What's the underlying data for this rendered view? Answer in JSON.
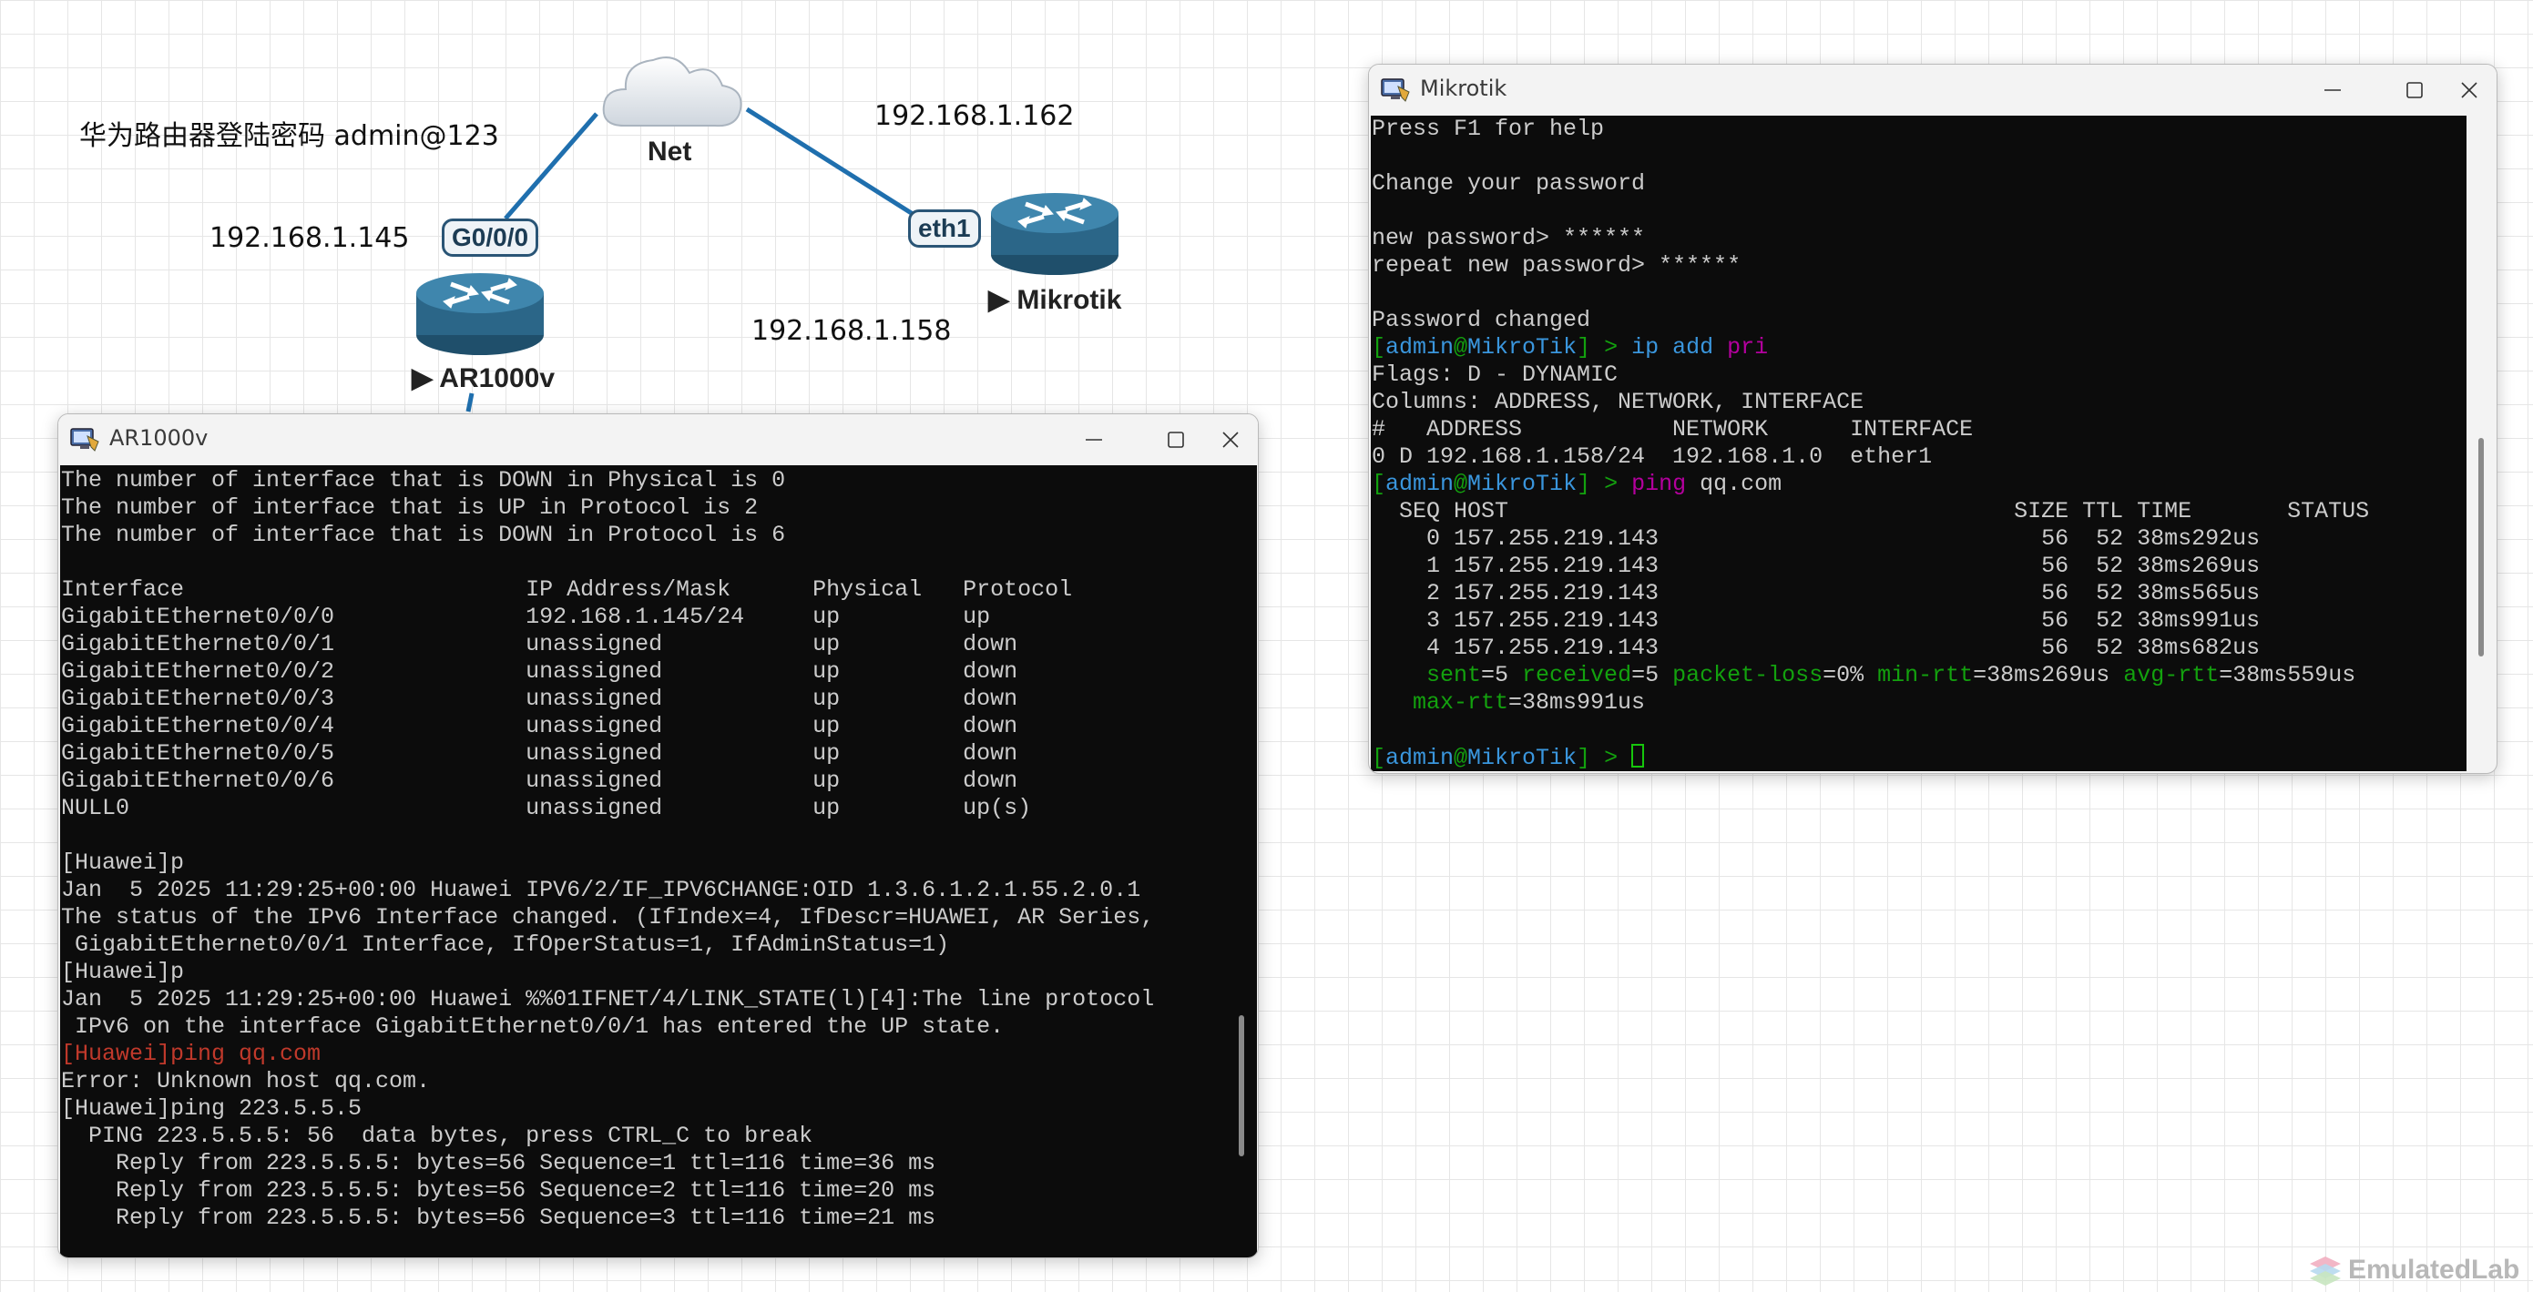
{
  "topology": {
    "note": "华为路由器登陆密码 admin@123",
    "ip_ar_side": "192.168.1.145",
    "ip_net_mikrotik": "192.168.1.162",
    "ip_mikrotik": "192.168.1.158",
    "cloud_label": "Net",
    "ar_node_label": "▶ AR1000v",
    "mikrotik_node_label": "▶ Mikrotik",
    "ar_iface_badge": "G0/0/0",
    "mikrotik_iface_badge": "eth1",
    "link_color": "#1f6fae"
  },
  "ar_window": {
    "title": "AR1000v",
    "lines": [
      [
        {
          "t": "The number of interface that is DOWN in Physical is 0"
        }
      ],
      [
        {
          "t": "The number of interface that is UP in Protocol is 2"
        }
      ],
      [
        {
          "t": "The number of interface that is DOWN in Protocol is 6"
        }
      ],
      [
        {
          "t": ""
        }
      ],
      [
        {
          "t": "Interface                         IP Address/Mask      Physical   Protocol"
        }
      ],
      [
        {
          "t": "GigabitEthernet0/0/0              192.168.1.145/24     up         up"
        }
      ],
      [
        {
          "t": "GigabitEthernet0/0/1              unassigned           up         down"
        }
      ],
      [
        {
          "t": "GigabitEthernet0/0/2              unassigned           up         down"
        }
      ],
      [
        {
          "t": "GigabitEthernet0/0/3              unassigned           up         down"
        }
      ],
      [
        {
          "t": "GigabitEthernet0/0/4              unassigned           up         down"
        }
      ],
      [
        {
          "t": "GigabitEthernet0/0/5              unassigned           up         down"
        }
      ],
      [
        {
          "t": "GigabitEthernet0/0/6              unassigned           up         down"
        }
      ],
      [
        {
          "t": "NULL0                             unassigned           up         up(s)"
        }
      ],
      [
        {
          "t": ""
        }
      ],
      [
        {
          "t": "[Huawei]p"
        }
      ],
      [
        {
          "t": "Jan  5 2025 11:29:25+00:00 Huawei IPV6/2/IF_IPV6CHANGE:OID 1.3.6.1.2.1.55.2.0.1"
        }
      ],
      [
        {
          "t": "The status of the IPv6 Interface changed. (IfIndex=4, IfDescr=HUAWEI, AR Series,"
        }
      ],
      [
        {
          "t": " GigabitEthernet0/0/1 Interface, IfOperStatus=1, IfAdminStatus=1)"
        }
      ],
      [
        {
          "t": "[Huawei]p"
        }
      ],
      [
        {
          "t": "Jan  5 2025 11:29:25+00:00 Huawei %%01IFNET/4/LINK_STATE(l)[4]:The line protocol"
        }
      ],
      [
        {
          "t": " IPv6 on the interface GigabitEthernet0/0/1 has entered the UP state."
        }
      ],
      [
        {
          "t": "[Huawei]ping qq.com",
          "c": "red"
        }
      ],
      [
        {
          "t": "Error: Unknown host qq.com."
        }
      ],
      [
        {
          "t": "[Huawei]ping 223.5.5.5"
        }
      ],
      [
        {
          "t": "  PING 223.5.5.5: 56  data bytes, press CTRL_C to break"
        }
      ],
      [
        {
          "t": "    Reply from 223.5.5.5: bytes=56 Sequence=1 ttl=116 time=36 ms"
        }
      ],
      [
        {
          "t": "    Reply from 223.5.5.5: bytes=56 Sequence=2 ttl=116 time=20 ms"
        }
      ],
      [
        {
          "t": "    Reply from 223.5.5.5: bytes=56 Sequence=3 ttl=116 time=21 ms"
        }
      ]
    ]
  },
  "mikrotik_window": {
    "title": "Mikrotik",
    "lines": [
      [
        {
          "t": "Press F1 for help"
        }
      ],
      [
        {
          "t": ""
        }
      ],
      [
        {
          "t": "Change your password"
        }
      ],
      [
        {
          "t": ""
        }
      ],
      [
        {
          "t": "new password> ******"
        }
      ],
      [
        {
          "t": "repeat new password> ******"
        }
      ],
      [
        {
          "t": ""
        }
      ],
      [
        {
          "t": "Password changed"
        }
      ],
      [
        {
          "t": "[",
          "c": "green"
        },
        {
          "t": "admin",
          "c": "cyan"
        },
        {
          "t": "@",
          "c": "green"
        },
        {
          "t": "MikroTik",
          "c": "cyan"
        },
        {
          "t": "] > ",
          "c": "green"
        },
        {
          "t": "ip add ",
          "c": "cyan"
        },
        {
          "t": "pri",
          "c": "mag"
        }
      ],
      [
        {
          "t": "Flags: D - DYNAMIC"
        }
      ],
      [
        {
          "t": "Columns: ADDRESS, NETWORK, INTERFACE"
        }
      ],
      [
        {
          "t": "#   ADDRESS           NETWORK      INTERFACE"
        }
      ],
      [
        {
          "t": "0 D 192.168.1.158/24  192.168.1.0  ether1"
        }
      ],
      [
        {
          "t": "[",
          "c": "green"
        },
        {
          "t": "admin",
          "c": "cyan"
        },
        {
          "t": "@",
          "c": "green"
        },
        {
          "t": "MikroTik",
          "c": "cyan"
        },
        {
          "t": "] > ",
          "c": "green"
        },
        {
          "t": "ping ",
          "c": "mag"
        },
        {
          "t": "qq.com"
        }
      ],
      [
        {
          "t": "  SEQ HOST                                     SIZE TTL TIME       STATUS"
        }
      ],
      [
        {
          "t": "    0 157.255.219.143                            56  52 38ms292us"
        }
      ],
      [
        {
          "t": "    1 157.255.219.143                            56  52 38ms269us"
        }
      ],
      [
        {
          "t": "    2 157.255.219.143                            56  52 38ms565us"
        }
      ],
      [
        {
          "t": "    3 157.255.219.143                            56  52 38ms991us"
        }
      ],
      [
        {
          "t": "    4 157.255.219.143                            56  52 38ms682us"
        }
      ],
      [
        {
          "t": "    sent",
          "c": "green"
        },
        {
          "t": "=5 "
        },
        {
          "t": "received",
          "c": "green"
        },
        {
          "t": "=5 "
        },
        {
          "t": "packet-loss",
          "c": "green"
        },
        {
          "t": "=0% "
        },
        {
          "t": "min-rtt",
          "c": "green"
        },
        {
          "t": "=38ms269us "
        },
        {
          "t": "avg-rtt",
          "c": "green"
        },
        {
          "t": "=38ms559us"
        }
      ],
      [
        {
          "t": "   max-rtt",
          "c": "green"
        },
        {
          "t": "=38ms991us"
        }
      ],
      [
        {
          "t": ""
        }
      ],
      [
        {
          "t": "[",
          "c": "green"
        },
        {
          "t": "admin",
          "c": "cyan"
        },
        {
          "t": "@",
          "c": "green"
        },
        {
          "t": "MikroTik",
          "c": "cyan"
        },
        {
          "t": "] > ",
          "c": "green"
        },
        {
          "cursor": true
        }
      ]
    ]
  },
  "watermark": "EmulatedLab",
  "icons": {
    "router": "router-icon",
    "cloud": "cloud-icon",
    "app": "terminal-app-icon",
    "minimize": "minimize-icon",
    "maximize": "maximize-icon",
    "close": "close-icon"
  }
}
